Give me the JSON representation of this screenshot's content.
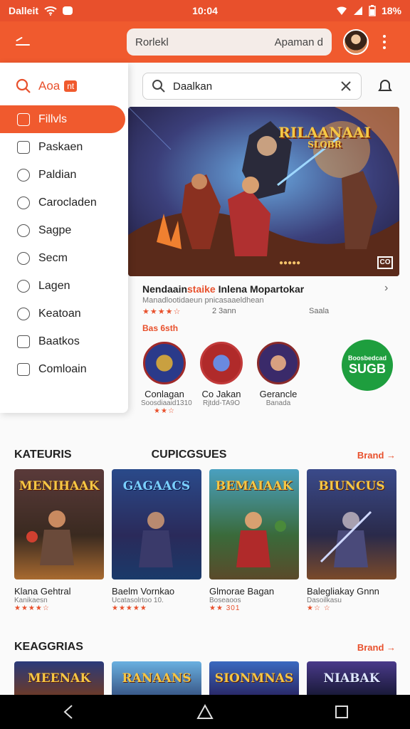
{
  "status": {
    "carrier": "Dalleit",
    "time": "10:04",
    "battery": "18%"
  },
  "app_bar": {
    "search_left": "Rorlekl",
    "search_right": "Apaman d"
  },
  "drawer": {
    "title": "Aoa",
    "tag": "nt",
    "items": [
      {
        "label": "Fillvls",
        "icon": "home-icon",
        "active": true
      },
      {
        "label": "Paskaen",
        "icon": "calendar-icon"
      },
      {
        "label": "Paldian",
        "icon": "leaf-icon"
      },
      {
        "label": "Carocladen",
        "icon": "carousel-icon"
      },
      {
        "label": "Sagpe",
        "icon": "tag-icon"
      },
      {
        "label": "Secm",
        "icon": "clock-icon"
      },
      {
        "label": "Lagen",
        "icon": "circle-icon"
      },
      {
        "label": "Keatoan",
        "icon": "stack-icon"
      },
      {
        "label": "Baatkos",
        "icon": "window-icon"
      },
      {
        "label": "Comloain",
        "icon": "box-icon"
      }
    ]
  },
  "search": {
    "value": "Daalkan"
  },
  "banner": {
    "title": "RILAANAAI",
    "subtitle": "SLOBR",
    "chip": "●●●●●",
    "badge": "CO"
  },
  "featured": {
    "title_a": "Nendaain",
    "title_b": "staike",
    "title_c": " Inlena Mopartokar",
    "sub": "Manadlootidaeun pnicasaaeldhean",
    "stars": "★★★★☆",
    "count": "2 3ann",
    "meta": "Saala",
    "section_label": "Bas 6sth"
  },
  "mini_games": [
    {
      "name": "Conlagan",
      "dev": "Soosdiaaid1310",
      "stars": "★★☆"
    },
    {
      "name": "Co Jakan",
      "dev": "Rjtdd-TA9O",
      "stars": ""
    },
    {
      "name": "Gerancle",
      "dev": "Banada",
      "stars": ""
    }
  ],
  "green_badge": {
    "top": "Boosbedcad",
    "main": "SUGB"
  },
  "sections": {
    "categories_label": "KATEURIS",
    "second_label": "CUPICGSUES",
    "more_label": "Brand →",
    "featured2_label": "KEAGGRIAS",
    "more2_label": "Brand →"
  },
  "cards": [
    {
      "art_title": "MENIHAAK",
      "title": "Klana Gehtral",
      "sub": "Kanikaesn",
      "stars": "★★★★☆"
    },
    {
      "art_title": "GAGAACS",
      "title": "Baelm Vornkao",
      "sub": "Ucatasolrtoo 10.",
      "stars": "★★★★★"
    },
    {
      "art_title": "BEMAIAAK",
      "title": "Glmorae Bagan",
      "sub": "Boseaoos",
      "stars": "★★ 301"
    },
    {
      "art_title": "BIUNCUS",
      "title": "Balegliakay Gnnn",
      "sub": "Dasoilkasu",
      "stars": "★☆ ☆"
    }
  ],
  "cards2": [
    {
      "art_title": "MEENAK"
    },
    {
      "art_title": "RANAANS"
    },
    {
      "art_title": "SIONMNAS"
    },
    {
      "art_title": "NIABAK"
    }
  ]
}
